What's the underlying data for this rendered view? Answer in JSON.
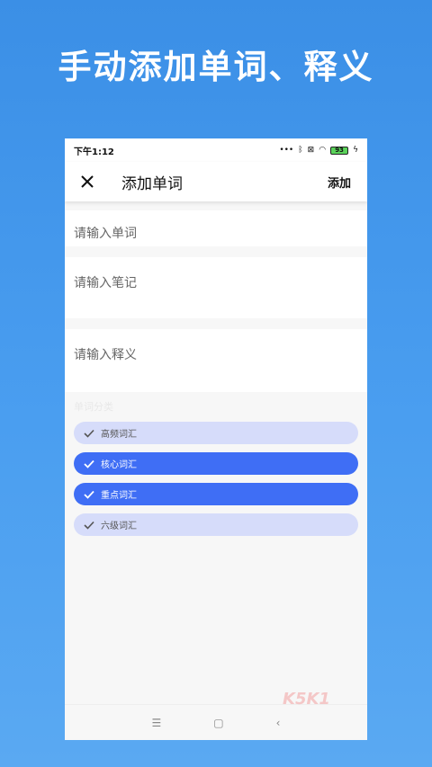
{
  "headline": "手动添加单词、释义",
  "status_bar": {
    "time": "下午1:12",
    "battery": "93"
  },
  "app_bar": {
    "title": "添加单词",
    "action": "添加"
  },
  "form": {
    "word_placeholder": "请输入单词",
    "note_placeholder": "请输入笔记",
    "definition_placeholder": "请输入释义"
  },
  "tags": {
    "label": "单词分类",
    "items": [
      {
        "label": "高频词汇",
        "selected": false
      },
      {
        "label": "核心词汇",
        "selected": true
      },
      {
        "label": "重点词汇",
        "selected": true
      },
      {
        "label": "六级词汇",
        "selected": false
      }
    ]
  },
  "colors": {
    "accent": "#3f6ef5",
    "chip_off": "#d6dcfa",
    "background": "#3b8fe6"
  },
  "watermark": "K5K1"
}
